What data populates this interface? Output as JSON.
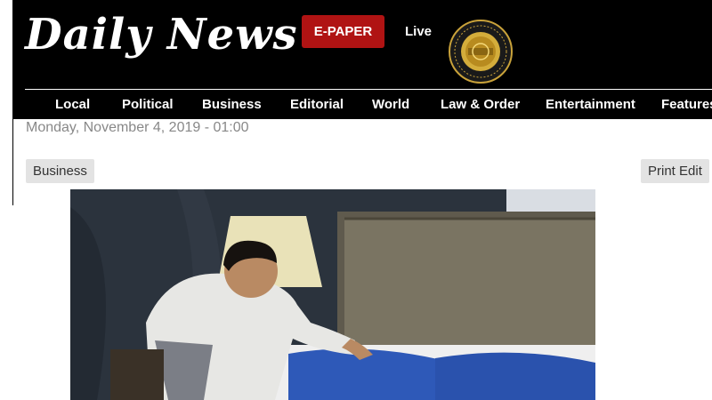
{
  "header": {
    "logo_text": "Daily News",
    "epaper_label": "E-PAPER",
    "live_label": "Live",
    "seal_icon": "award-seal-icon"
  },
  "nav": {
    "items": [
      {
        "label": "Local"
      },
      {
        "label": "Political"
      },
      {
        "label": "Business"
      },
      {
        "label": "Editorial"
      },
      {
        "label": "World"
      },
      {
        "label": "Law & Order"
      },
      {
        "label": "Entertainment"
      },
      {
        "label": "Features"
      }
    ]
  },
  "article": {
    "date": "Monday, November 4, 2019 - 01:00",
    "category_label": "Business",
    "print_label": "Print Edit"
  },
  "colors": {
    "header_bg": "#000000",
    "epaper_bg": "#b01313",
    "tag_bg": "#e3e3e3"
  }
}
